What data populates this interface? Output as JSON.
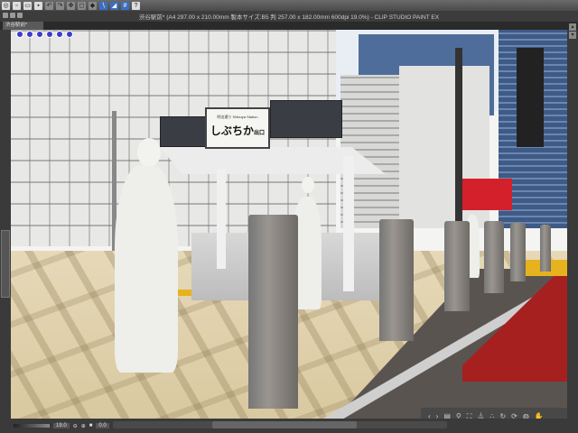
{
  "app": {
    "title": "渋谷駅前* (A4 297.00 x 210.00mm 製本サイズ:B5 判 257.00 x 182.00mm 600dpi 19.0%)  - CLIP STUDIO PAINT EX"
  },
  "document_tab": {
    "label": "渋谷駅前*"
  },
  "toolbar": {
    "icons": [
      "clip-studio-icon",
      "new-icon",
      "open-icon",
      "save-icon",
      "undo-icon",
      "redo-icon",
      "transform-icon",
      "clear-icon",
      "fill-icon",
      "snap-ruler-icon",
      "snap-special-ruler-icon",
      "snap-grid-icon",
      "help-icon"
    ],
    "help_label": "?"
  },
  "scene": {
    "sign_small": "明治通り  Shibuya Station",
    "sign_main": "しぶちか",
    "sign_sub": "出口"
  },
  "statusbar": {
    "zoom": "19.0",
    "angle": "0.0"
  },
  "navigator": {
    "icons": [
      "rotate-left-icon",
      "rotate-right-icon",
      "page-icon",
      "fit-icon",
      "fit-page-icon",
      "flip-icon",
      "lock-icon",
      "rotate-icon",
      "reset-icon",
      "navigator-icon",
      "hand-icon"
    ]
  },
  "colors": {
    "accent": "#3a6fc0",
    "red_lane": "#a62020",
    "tactile": "#e6b21e"
  }
}
